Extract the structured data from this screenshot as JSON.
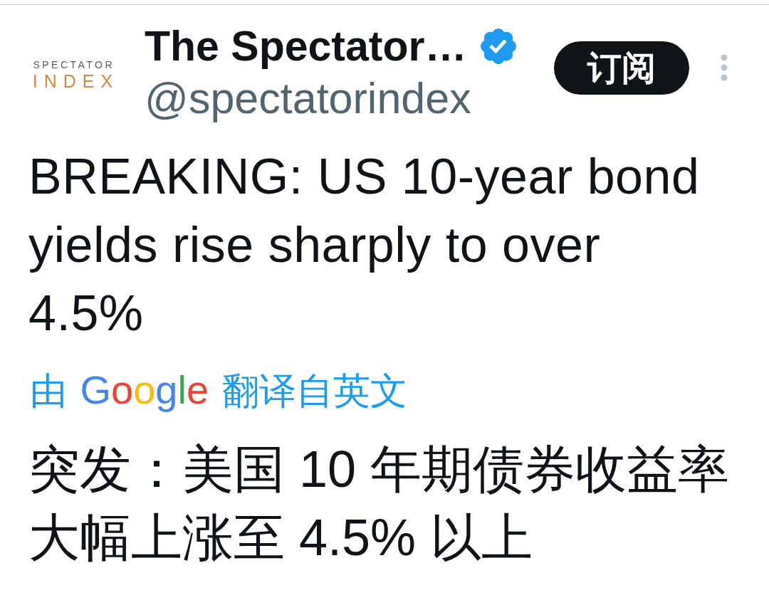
{
  "account": {
    "avatar": {
      "logo_top": "SPECTATOR",
      "logo_bottom": "INDEX"
    },
    "display_name": "The Spectator…",
    "verified": true,
    "handle": "@spectatorindex"
  },
  "subscribe_button": {
    "label": "订阅"
  },
  "tweet": {
    "text": "BREAKING: US 10-year bond yields rise sharply to over 4.5%"
  },
  "translation": {
    "prefix": "由",
    "provider_logo": [
      {
        "char": "G",
        "color": "#4285f4"
      },
      {
        "char": "o",
        "color": "#ea4335"
      },
      {
        "char": "o",
        "color": "#fbbc05"
      },
      {
        "char": "g",
        "color": "#4285f4"
      },
      {
        "char": "l",
        "color": "#34a853"
      },
      {
        "char": "e",
        "color": "#ea4335"
      }
    ],
    "suffix": "翻译自英文",
    "text": "突发：美国 10 年期债券收益率大幅上涨至 4.5% 以上"
  }
}
